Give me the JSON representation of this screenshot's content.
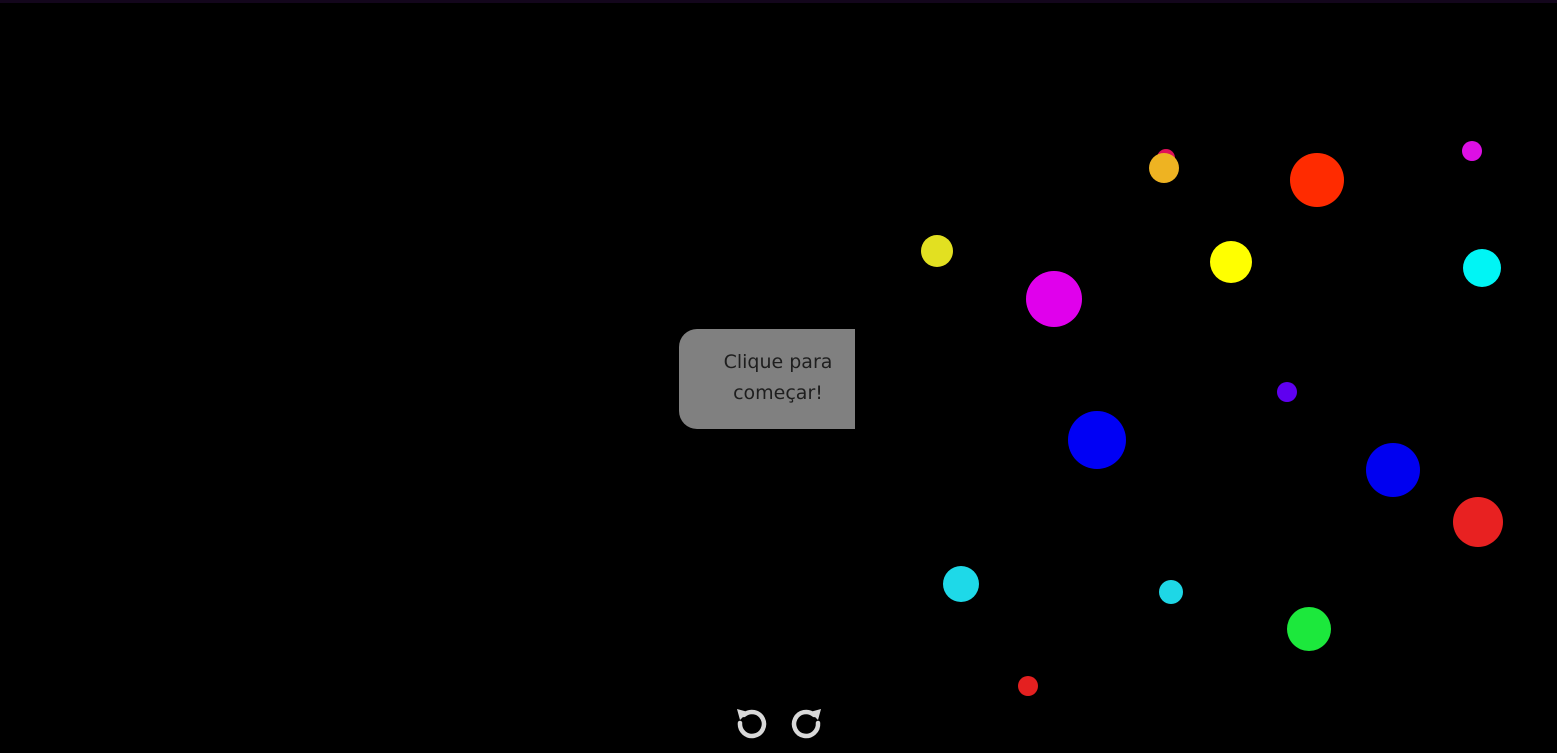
{
  "start_prompt": {
    "line1": "Clique para",
    "line2": "começar!"
  },
  "controls": {
    "undo_icon": "undo-icon",
    "redo_icon": "redo-icon",
    "icon_color": "#d9d9d9"
  },
  "colors": {
    "background": "#000000",
    "button": "#808080",
    "button_text": "#1e1e1e"
  },
  "balls": [
    {
      "color": "#e0105a"
    },
    {
      "color": "#eeb322"
    },
    {
      "color": "#ff2b00"
    },
    {
      "color": "#dd0fe5"
    },
    {
      "color": "#e2e021"
    },
    {
      "color": "#ffff00"
    },
    {
      "color": "#00f5f5"
    },
    {
      "color": "#e000ec"
    },
    {
      "color": "#5f00f0"
    },
    {
      "color": "#0000f5"
    },
    {
      "color": "#0000f0"
    },
    {
      "color": "#e82121"
    },
    {
      "color": "#1ed9e8"
    },
    {
      "color": "#1ed7e6"
    },
    {
      "color": "#1ce83c"
    },
    {
      "color": "#e42020"
    }
  ]
}
